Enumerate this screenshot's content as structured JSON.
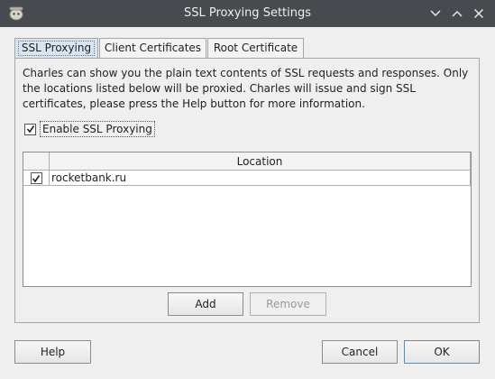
{
  "window": {
    "title": "SSL Proxying Settings"
  },
  "tabs": [
    {
      "label": "SSL Proxying",
      "active": true
    },
    {
      "label": "Client Certificates",
      "active": false
    },
    {
      "label": "Root Certificate",
      "active": false
    }
  ],
  "ssl_proxying": {
    "description": "Charles can show you the plain text contents of SSL requests and responses. Only the locations listed below will be proxied. Charles will issue and sign SSL certificates, please press the Help button for more information.",
    "enable_label": "Enable SSL Proxying",
    "enable_checked": true,
    "table": {
      "columns": [
        "",
        "Location"
      ],
      "rows": [
        {
          "checked": true,
          "location": "rocketbank.ru"
        }
      ]
    },
    "add_label": "Add",
    "remove_label": "Remove"
  },
  "footer": {
    "help_label": "Help",
    "cancel_label": "Cancel",
    "ok_label": "OK"
  },
  "icons": {
    "app": "charles-app-icon",
    "minimize": "chevron-down-icon",
    "maximize": "chevron-up-icon",
    "close": "close-icon",
    "check": "checkmark-icon"
  }
}
